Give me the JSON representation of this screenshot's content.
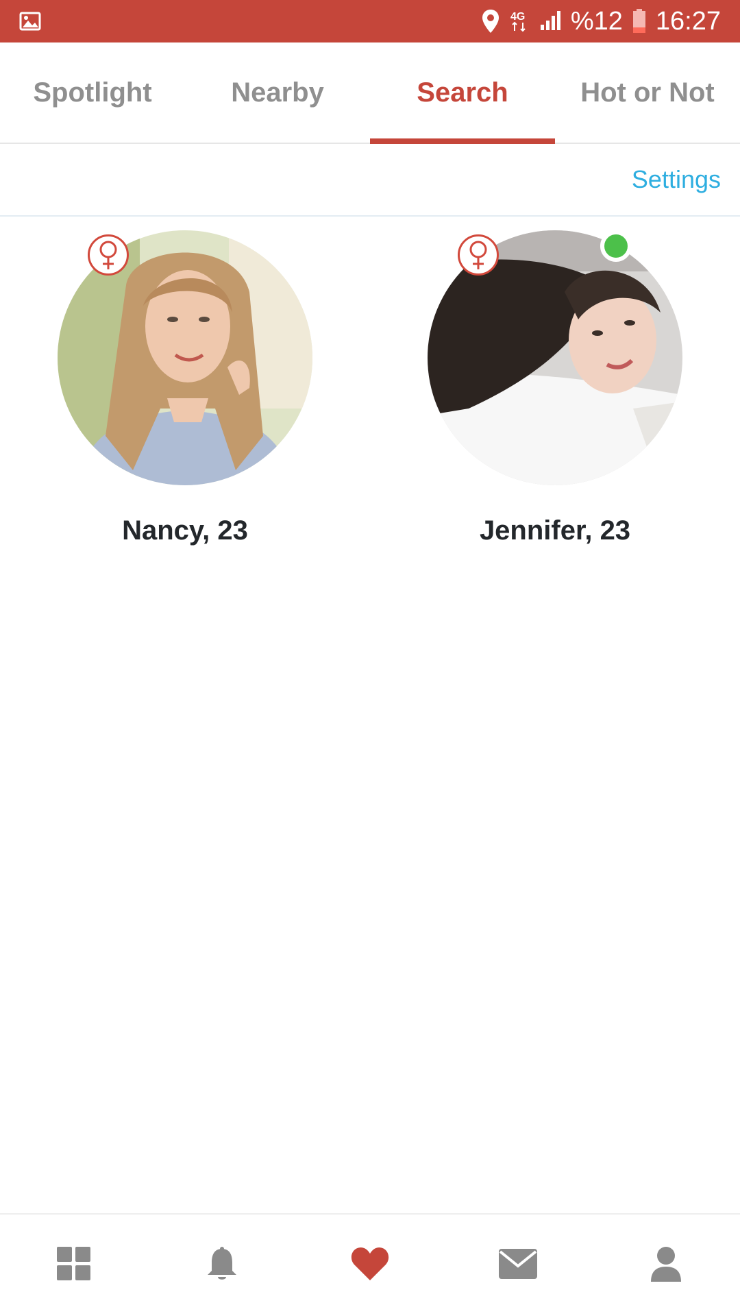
{
  "status_bar": {
    "network": "4G",
    "battery_text": "%12",
    "time": "16:27",
    "icons": [
      "image-icon",
      "location-icon",
      "network-icon",
      "signal-icon",
      "battery-icon"
    ]
  },
  "tabs": [
    {
      "label": "Spotlight",
      "active": false
    },
    {
      "label": "Nearby",
      "active": false
    },
    {
      "label": "Search",
      "active": true
    },
    {
      "label": "Hot or Not",
      "active": false
    }
  ],
  "settings": {
    "label": "Settings"
  },
  "profiles": [
    {
      "name_age": "Nancy, 23",
      "gender_icon": "female-icon",
      "online": false
    },
    {
      "name_age": "Jennifer, 23",
      "gender_icon": "female-icon",
      "online": true
    }
  ],
  "bottom_nav": {
    "items": [
      "grid-icon",
      "bell-icon",
      "heart-icon",
      "mail-icon",
      "profile-icon"
    ],
    "active": "heart-icon"
  },
  "colors": {
    "brand": "#c5463a",
    "link": "#2eaee0",
    "online": "#4cc04a",
    "inactive": "#8f8f8f"
  }
}
